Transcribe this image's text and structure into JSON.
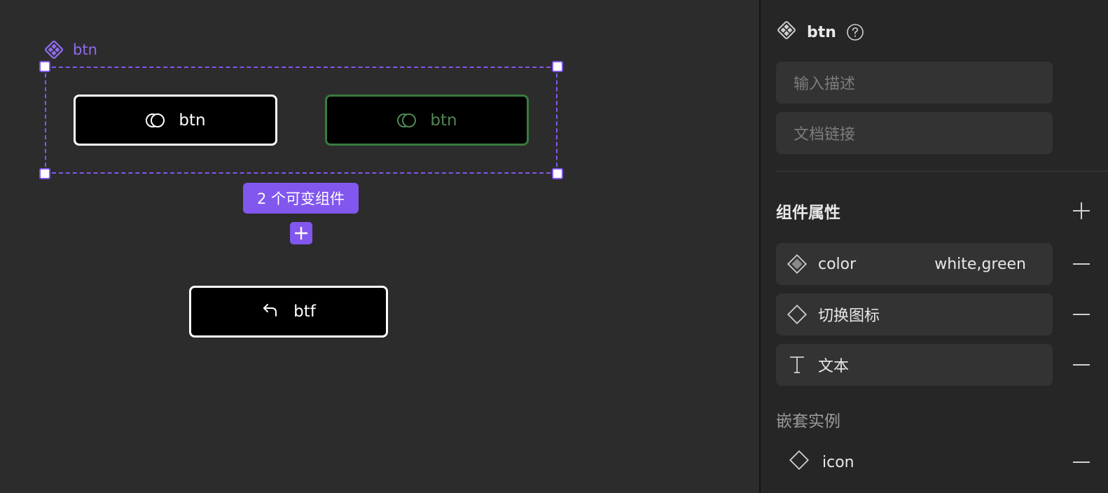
{
  "canvas": {
    "component_set_label": "btn",
    "variant_count_badge": "2 个可变组件",
    "variants": [
      {
        "label": "btn",
        "color": "white",
        "border_color": "#ffffff"
      },
      {
        "label": "btn",
        "color": "green",
        "border_color": "#3a7a3e"
      }
    ],
    "instance": {
      "label": "btf"
    },
    "accent_color": "#8157ee"
  },
  "panel": {
    "component_name": "btn",
    "description_placeholder": "输入描述",
    "doc_link_placeholder": "文档链接",
    "properties_title": "组件属性",
    "properties": [
      {
        "icon": "variant-icon",
        "name": "color",
        "value": "white,green"
      },
      {
        "icon": "boolean-diamond-icon",
        "name": "切换图标",
        "value": ""
      },
      {
        "icon": "text-icon",
        "name": "文本",
        "value": ""
      }
    ],
    "nested_title": "嵌套实例",
    "nested_instances": [
      {
        "icon": "instance-diamond-icon",
        "name": "icon"
      }
    ]
  }
}
